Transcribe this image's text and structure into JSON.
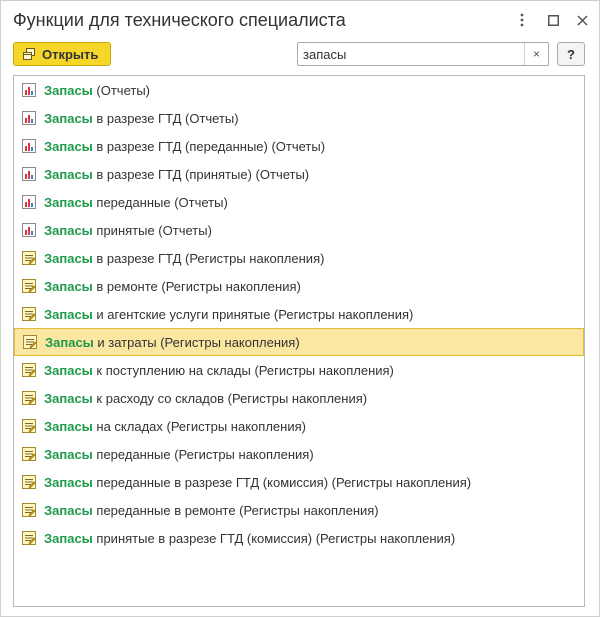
{
  "window": {
    "title": "Функции для технического специалиста"
  },
  "titlebar_icons": [
    "more-vertical-icon",
    "maximize-icon",
    "close-icon"
  ],
  "toolbar": {
    "open_label": "Открыть",
    "open_icon": "open-form-icon"
  },
  "search": {
    "value": "запасы",
    "clear_label": "×"
  },
  "help": {
    "label": "?"
  },
  "colors": {
    "accent": "#f6d629",
    "highlight": "#1f9a4b",
    "selected_bg": "#fbe6a2"
  },
  "list": {
    "selected_index": 9,
    "items": [
      {
        "icon": "report-icon",
        "match": "Запасы",
        "rest": " (Отчеты)"
      },
      {
        "icon": "report-icon",
        "match": "Запасы",
        "rest": " в разрезе ГТД (Отчеты)"
      },
      {
        "icon": "report-icon",
        "match": "Запасы",
        "rest": " в разрезе ГТД (переданные) (Отчеты)"
      },
      {
        "icon": "report-icon",
        "match": "Запасы",
        "rest": " в разрезе ГТД (принятые) (Отчеты)"
      },
      {
        "icon": "report-icon",
        "match": "Запасы",
        "rest": " переданные (Отчеты)"
      },
      {
        "icon": "report-icon",
        "match": "Запасы",
        "rest": " принятые (Отчеты)"
      },
      {
        "icon": "register-icon",
        "match": "Запасы",
        "rest": " в разрезе ГТД (Регистры накопления)"
      },
      {
        "icon": "register-icon",
        "match": "Запасы",
        "rest": " в ремонте (Регистры накопления)"
      },
      {
        "icon": "register-icon",
        "match": "Запасы",
        "rest": " и агентские услуги принятые (Регистры накопления)"
      },
      {
        "icon": "register-icon",
        "match": "Запасы",
        "rest": " и затраты (Регистры накопления)"
      },
      {
        "icon": "register-icon",
        "match": "Запасы",
        "rest": " к поступлению на склады (Регистры накопления)"
      },
      {
        "icon": "register-icon",
        "match": "Запасы",
        "rest": " к расходу со складов (Регистры накопления)"
      },
      {
        "icon": "register-icon",
        "match": "Запасы",
        "rest": " на складах (Регистры накопления)"
      },
      {
        "icon": "register-icon",
        "match": "Запасы",
        "rest": " переданные (Регистры накопления)"
      },
      {
        "icon": "register-icon",
        "match": "Запасы",
        "rest": " переданные в разрезе ГТД (комиссия) (Регистры накопления)"
      },
      {
        "icon": "register-icon",
        "match": "Запасы",
        "rest": " переданные в ремонте (Регистры накопления)"
      },
      {
        "icon": "register-icon",
        "match": "Запасы",
        "rest": " принятые в разрезе ГТД (комиссия) (Регистры накопления)"
      }
    ]
  }
}
